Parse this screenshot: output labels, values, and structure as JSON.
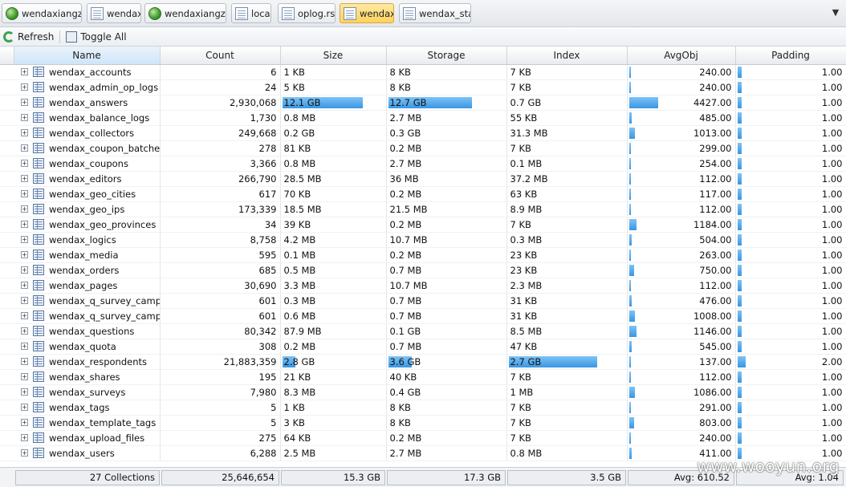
{
  "tabs": [
    {
      "label": "wendaxiangzi",
      "icon": "server-globe-icon",
      "active": false
    },
    {
      "label": "wendax",
      "icon": "database-page-icon",
      "active": false
    },
    {
      "label": "wendaxiangzi",
      "icon": "server-globe-icon",
      "active": false
    },
    {
      "label": "local",
      "icon": "database-page-icon",
      "active": false
    },
    {
      "label": "oplog.rs",
      "icon": "collection-icon",
      "active": false
    },
    {
      "label": "wendax",
      "icon": "database-page-icon",
      "active": true
    },
    {
      "label": "wendax_stat",
      "icon": "database-page-icon",
      "active": false
    }
  ],
  "tab_menu": "▼",
  "toolbar": {
    "refresh_label": "Refresh",
    "toggle_all_label": "Toggle All"
  },
  "columns": [
    "Name",
    "Count",
    "Size",
    "Storage",
    "Index",
    "AvgObj",
    "Padding"
  ],
  "colors": {
    "bar": "#3996e3",
    "active_tab": "#ffd35c",
    "sorted_header": "#cfe5f8"
  },
  "rows": [
    {
      "name": "wendax_accounts",
      "count": "6",
      "size": "1 KB",
      "storage": "8 KB",
      "index": "7 KB",
      "avgobj": "240.00",
      "padding": "1.00",
      "size_frac": 0,
      "storage_frac": 0,
      "index_frac": 0,
      "avgobj_frac": 0.02,
      "padding_frac": 0.04
    },
    {
      "name": "wendax_admin_op_logs",
      "count": "24",
      "size": "5 KB",
      "storage": "8 KB",
      "index": "7 KB",
      "avgobj": "240.00",
      "padding": "1.00",
      "size_frac": 0,
      "storage_frac": 0,
      "index_frac": 0,
      "avgobj_frac": 0.02,
      "padding_frac": 0.04
    },
    {
      "name": "wendax_answers",
      "count": "2,930,068",
      "size": "12.1 GB",
      "storage": "12.7 GB",
      "index": "0.7 GB",
      "avgobj": "4427.00",
      "padding": "1.00",
      "size_frac": 1.0,
      "storage_frac": 0.72,
      "index_frac": 0,
      "avgobj_frac": 0.28,
      "padding_frac": 0.04
    },
    {
      "name": "wendax_balance_logs",
      "count": "1,730",
      "size": "0.8 MB",
      "storage": "2.7 MB",
      "index": "55 KB",
      "avgobj": "485.00",
      "padding": "1.00",
      "size_frac": 0,
      "storage_frac": 0,
      "index_frac": 0,
      "avgobj_frac": 0.03,
      "padding_frac": 0.04
    },
    {
      "name": "wendax_collectors",
      "count": "249,668",
      "size": "0.2 GB",
      "storage": "0.3 GB",
      "index": "31.3 MB",
      "avgobj": "1013.00",
      "padding": "1.00",
      "size_frac": 0,
      "storage_frac": 0,
      "index_frac": 0,
      "avgobj_frac": 0.06,
      "padding_frac": 0.04
    },
    {
      "name": "wendax_coupon_batches",
      "count": "278",
      "size": "81 KB",
      "storage": "0.2 MB",
      "index": "7 KB",
      "avgobj": "299.00",
      "padding": "1.00",
      "size_frac": 0,
      "storage_frac": 0,
      "index_frac": 0,
      "avgobj_frac": 0.02,
      "padding_frac": 0.04
    },
    {
      "name": "wendax_coupons",
      "count": "3,366",
      "size": "0.8 MB",
      "storage": "2.7 MB",
      "index": "0.1 MB",
      "avgobj": "254.00",
      "padding": "1.00",
      "size_frac": 0,
      "storage_frac": 0,
      "index_frac": 0,
      "avgobj_frac": 0.02,
      "padding_frac": 0.04
    },
    {
      "name": "wendax_editors",
      "count": "266,790",
      "size": "28.5 MB",
      "storage": "36 MB",
      "index": "37.2 MB",
      "avgobj": "112.00",
      "padding": "1.00",
      "size_frac": 0,
      "storage_frac": 0,
      "index_frac": 0,
      "avgobj_frac": 0.01,
      "padding_frac": 0.04
    },
    {
      "name": "wendax_geo_cities",
      "count": "617",
      "size": "70 KB",
      "storage": "0.2 MB",
      "index": "63 KB",
      "avgobj": "117.00",
      "padding": "1.00",
      "size_frac": 0,
      "storage_frac": 0,
      "index_frac": 0,
      "avgobj_frac": 0.01,
      "padding_frac": 0.04
    },
    {
      "name": "wendax_geo_ips",
      "count": "173,339",
      "size": "18.5 MB",
      "storage": "21.5 MB",
      "index": "8.9 MB",
      "avgobj": "112.00",
      "padding": "1.00",
      "size_frac": 0,
      "storage_frac": 0,
      "index_frac": 0,
      "avgobj_frac": 0.01,
      "padding_frac": 0.04
    },
    {
      "name": "wendax_geo_provinces",
      "count": "34",
      "size": "39 KB",
      "storage": "0.2 MB",
      "index": "7 KB",
      "avgobj": "1184.00",
      "padding": "1.00",
      "size_frac": 0,
      "storage_frac": 0,
      "index_frac": 0,
      "avgobj_frac": 0.07,
      "padding_frac": 0.04
    },
    {
      "name": "wendax_logics",
      "count": "8,758",
      "size": "4.2 MB",
      "storage": "10.7 MB",
      "index": "0.3 MB",
      "avgobj": "504.00",
      "padding": "1.00",
      "size_frac": 0,
      "storage_frac": 0,
      "index_frac": 0,
      "avgobj_frac": 0.03,
      "padding_frac": 0.04
    },
    {
      "name": "wendax_media",
      "count": "595",
      "size": "0.1 MB",
      "storage": "0.2 MB",
      "index": "23 KB",
      "avgobj": "263.00",
      "padding": "1.00",
      "size_frac": 0,
      "storage_frac": 0,
      "index_frac": 0,
      "avgobj_frac": 0.02,
      "padding_frac": 0.04
    },
    {
      "name": "wendax_orders",
      "count": "685",
      "size": "0.5 MB",
      "storage": "0.7 MB",
      "index": "23 KB",
      "avgobj": "750.00",
      "padding": "1.00",
      "size_frac": 0,
      "storage_frac": 0,
      "index_frac": 0,
      "avgobj_frac": 0.05,
      "padding_frac": 0.04
    },
    {
      "name": "wendax_pages",
      "count": "30,690",
      "size": "3.3 MB",
      "storage": "10.7 MB",
      "index": "2.3 MB",
      "avgobj": "112.00",
      "padding": "1.00",
      "size_frac": 0,
      "storage_frac": 0,
      "index_frac": 0,
      "avgobj_frac": 0.01,
      "padding_frac": 0.04
    },
    {
      "name": "wendax_q_survey_camp...",
      "count": "601",
      "size": "0.3 MB",
      "storage": "0.7 MB",
      "index": "31 KB",
      "avgobj": "476.00",
      "padding": "1.00",
      "size_frac": 0,
      "storage_frac": 0,
      "index_frac": 0,
      "avgobj_frac": 0.03,
      "padding_frac": 0.04
    },
    {
      "name": "wendax_q_survey_camp...",
      "count": "601",
      "size": "0.6 MB",
      "storage": "0.7 MB",
      "index": "31 KB",
      "avgobj": "1008.00",
      "padding": "1.00",
      "size_frac": 0,
      "storage_frac": 0,
      "index_frac": 0,
      "avgobj_frac": 0.06,
      "padding_frac": 0.04
    },
    {
      "name": "wendax_questions",
      "count": "80,342",
      "size": "87.9 MB",
      "storage": "0.1 GB",
      "index": "8.5 MB",
      "avgobj": "1146.00",
      "padding": "1.00",
      "size_frac": 0,
      "storage_frac": 0,
      "index_frac": 0,
      "avgobj_frac": 0.07,
      "padding_frac": 0.04
    },
    {
      "name": "wendax_quota",
      "count": "308",
      "size": "0.2 MB",
      "storage": "0.7 MB",
      "index": "47 KB",
      "avgobj": "545.00",
      "padding": "1.00",
      "size_frac": 0,
      "storage_frac": 0,
      "index_frac": 0,
      "avgobj_frac": 0.03,
      "padding_frac": 0.04
    },
    {
      "name": "wendax_respondents",
      "count": "21,883,359",
      "size": "2.8 GB",
      "storage": "3.6 GB",
      "index": "2.7 GB",
      "avgobj": "137.00",
      "padding": "2.00",
      "size_frac": 0.16,
      "storage_frac": 0.2,
      "index_frac": 1.0,
      "avgobj_frac": 0.01,
      "padding_frac": 0.08
    },
    {
      "name": "wendax_shares",
      "count": "195",
      "size": "21 KB",
      "storage": "40 KB",
      "index": "7 KB",
      "avgobj": "112.00",
      "padding": "1.00",
      "size_frac": 0,
      "storage_frac": 0,
      "index_frac": 0,
      "avgobj_frac": 0.01,
      "padding_frac": 0.04
    },
    {
      "name": "wendax_surveys",
      "count": "7,980",
      "size": "8.3 MB",
      "storage": "0.4 GB",
      "index": "1 MB",
      "avgobj": "1086.00",
      "padding": "1.00",
      "size_frac": 0,
      "storage_frac": 0,
      "index_frac": 0,
      "avgobj_frac": 0.06,
      "padding_frac": 0.04
    },
    {
      "name": "wendax_tags",
      "count": "5",
      "size": "1 KB",
      "storage": "8 KB",
      "index": "7 KB",
      "avgobj": "291.00",
      "padding": "1.00",
      "size_frac": 0,
      "storage_frac": 0,
      "index_frac": 0,
      "avgobj_frac": 0.02,
      "padding_frac": 0.04
    },
    {
      "name": "wendax_template_tags",
      "count": "5",
      "size": "3 KB",
      "storage": "8 KB",
      "index": "7 KB",
      "avgobj": "803.00",
      "padding": "1.00",
      "size_frac": 0,
      "storage_frac": 0,
      "index_frac": 0,
      "avgobj_frac": 0.05,
      "padding_frac": 0.04
    },
    {
      "name": "wendax_upload_files",
      "count": "275",
      "size": "64 KB",
      "storage": "0.2 MB",
      "index": "7 KB",
      "avgobj": "240.00",
      "padding": "1.00",
      "size_frac": 0,
      "storage_frac": 0,
      "index_frac": 0,
      "avgobj_frac": 0.02,
      "padding_frac": 0.04
    },
    {
      "name": "wendax_users",
      "count": "6,288",
      "size": "2.5 MB",
      "storage": "2.7 MB",
      "index": "0.8 MB",
      "avgobj": "411.00",
      "padding": "1.00",
      "size_frac": 0,
      "storage_frac": 0,
      "index_frac": 0,
      "avgobj_frac": 0.03,
      "padding_frac": 0.04
    }
  ],
  "footer": {
    "collections": "27 Collections",
    "count": "25,646,654",
    "size": "15.3 GB",
    "storage": "17.3 GB",
    "index": "3.5 GB",
    "avgobj": "Avg: 610.52",
    "padding": "Avg: 1.04"
  },
  "watermark": "www.wooyun.org"
}
